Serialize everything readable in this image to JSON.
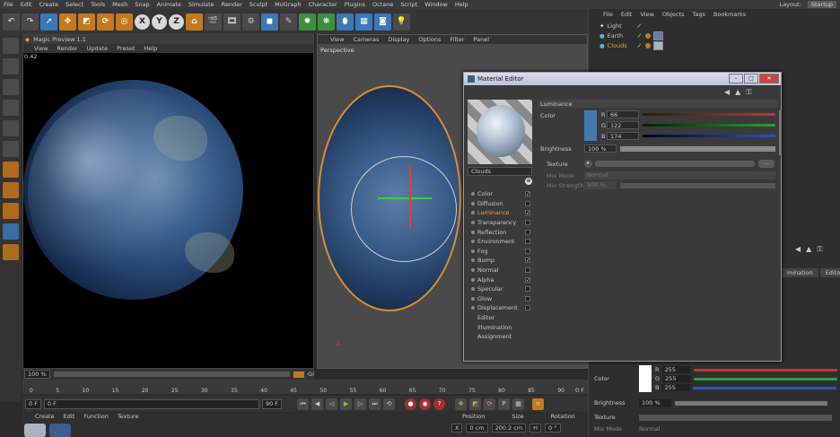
{
  "menubar": [
    "File",
    "Edit",
    "Create",
    "Select",
    "Tools",
    "Mesh",
    "Snap",
    "Animate",
    "Simulate",
    "Render",
    "Sculpt",
    "MoGraph",
    "Character",
    "Plugins",
    "Octane",
    "Script",
    "Window",
    "Help"
  ],
  "layout": {
    "label": "Layout:",
    "value": "Startup"
  },
  "toolbar": {
    "axis_x": "X",
    "axis_y": "Y",
    "axis_z": "Z"
  },
  "magic": {
    "title": "Magic Preview 1.1",
    "menu": [
      "View",
      "Render",
      "Update",
      "Preset",
      "Help"
    ],
    "fps": "0.42",
    "zoom": "100 %",
    "gi": "GI"
  },
  "viewport": {
    "menu": [
      "View",
      "Cameras",
      "Display",
      "Options",
      "Filter",
      "Panel"
    ],
    "label": "Perspective"
  },
  "timeline": {
    "ticks": [
      "0",
      "5",
      "10",
      "15",
      "20",
      "25",
      "30",
      "35",
      "40",
      "45",
      "50",
      "55",
      "60",
      "65",
      "70",
      "75",
      "80",
      "85",
      "90"
    ],
    "end": "0 F"
  },
  "playbar": {
    "start": "0 F",
    "current": "0 F",
    "end": "90 F"
  },
  "bottom": {
    "menu": [
      "Create",
      "Edit",
      "Function",
      "Texture"
    ],
    "pos_hdr": "Position",
    "size_hdr": "Size",
    "rot_hdr": "Rotation",
    "x_pos": "0 cm",
    "x_size": "200.2 cm",
    "x_rot": "0 °",
    "x_lbl": "X",
    "h_lbl": "H"
  },
  "objects": {
    "menu": [
      "File",
      "Edit",
      "View",
      "Objects",
      "Tags",
      "Bookmarks"
    ],
    "items": [
      {
        "name": "Light"
      },
      {
        "name": "Earth"
      },
      {
        "name": "Clouds"
      }
    ]
  },
  "attr": {
    "tab1": "mination",
    "tab2": "Edito",
    "color_lbl": "Color",
    "r": "255",
    "g": "255",
    "b": "255",
    "brightness_lbl": "Brightness",
    "brightness": "100 %",
    "texture_lbl": "Texture",
    "mix_lbl": "Mix Mode",
    "mix_val": "Normal"
  },
  "mat": {
    "title": "Material Editor",
    "name": "Clouds",
    "section": "Luminance",
    "color_lbl": "Color",
    "r": "66",
    "g": "122",
    "b": "174",
    "brightness_lbl": "Brightness",
    "brightness": "100 %",
    "texture_lbl": "Texture",
    "mixmode_lbl": "Mix Mode",
    "mixmode": "Normal",
    "mixstrength_lbl": "Mix Strength",
    "mixstrength": "100 %",
    "channels": [
      {
        "name": "Color",
        "on": "✓"
      },
      {
        "name": "Diffusion",
        "on": ""
      },
      {
        "name": "Luminance",
        "on": "✓"
      },
      {
        "name": "Transparency",
        "on": ""
      },
      {
        "name": "Reflection",
        "on": ""
      },
      {
        "name": "Environment",
        "on": ""
      },
      {
        "name": "Fog",
        "on": ""
      },
      {
        "name": "Bump",
        "on": "✓"
      },
      {
        "name": "Normal",
        "on": ""
      },
      {
        "name": "Alpha",
        "on": "✓"
      },
      {
        "name": "Specular",
        "on": ""
      },
      {
        "name": "Glow",
        "on": ""
      },
      {
        "name": "Displacement",
        "on": ""
      },
      {
        "name": "Editor",
        "on": ""
      },
      {
        "name": "Illumination",
        "on": ""
      },
      {
        "name": "Assignment",
        "on": ""
      }
    ]
  }
}
